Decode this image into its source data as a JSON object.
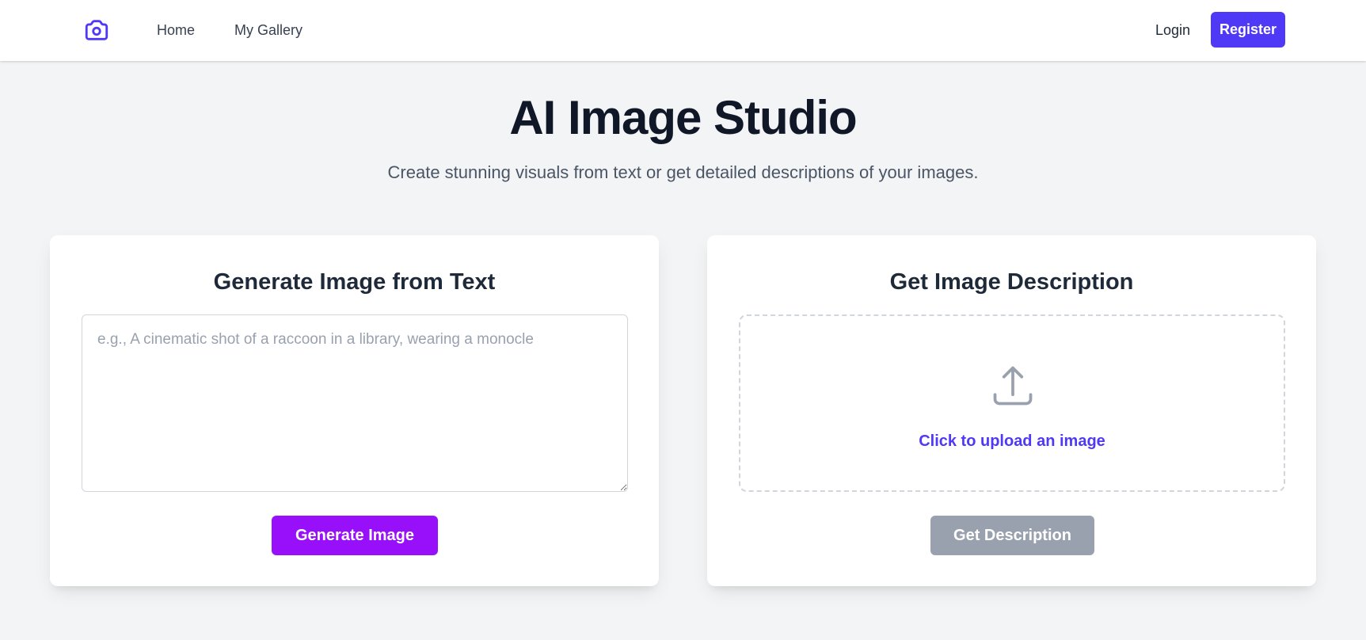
{
  "nav": {
    "logo_icon": "camera-icon",
    "home": "Home",
    "gallery": "My Gallery",
    "login": "Login",
    "register": "Register"
  },
  "hero": {
    "title": "AI Image Studio",
    "subtitle": "Create stunning visuals from text or get detailed descriptions of your images."
  },
  "generate": {
    "title": "Generate Image from Text",
    "prompt_value": "",
    "prompt_placeholder": "e.g., A cinematic shot of a raccoon in a library, wearing a monocle",
    "button": "Generate Image"
  },
  "describe": {
    "title": "Get Image Description",
    "upload_icon": "upload-icon",
    "upload_label": "Click to upload an image",
    "button": "Get Description",
    "button_disabled": true
  },
  "colors": {
    "accent": "#4f39f6",
    "generate_button": "#9810fa",
    "disabled_button": "#99a1af",
    "page_background": "#f3f4f6"
  }
}
